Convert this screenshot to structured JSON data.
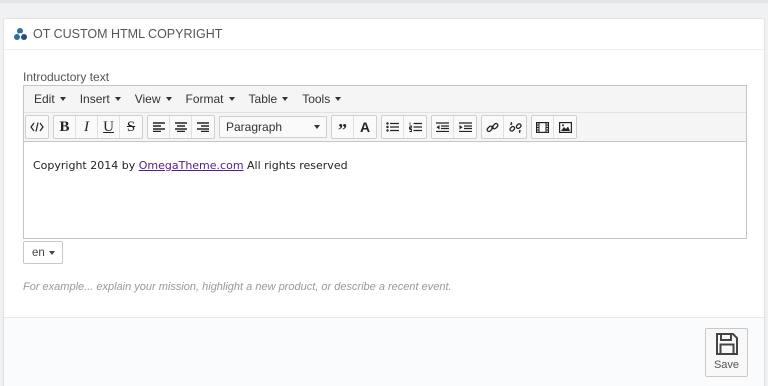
{
  "panel": {
    "title": "OT CUSTOM HTML COPYRIGHT"
  },
  "form": {
    "label": "Introductory text",
    "help": "For example... explain your mission, highlight a new product, or describe a recent event."
  },
  "editor": {
    "menu": [
      "Edit",
      "Insert",
      "View",
      "Format",
      "Table",
      "Tools"
    ],
    "format_select": "Paragraph",
    "content": {
      "prefix": "Copyright 2014 by ",
      "link": "OmegaTheme.com",
      "suffix": " All rights reserved"
    }
  },
  "language": {
    "selected": "en"
  },
  "footer": {
    "save_label": "Save"
  }
}
